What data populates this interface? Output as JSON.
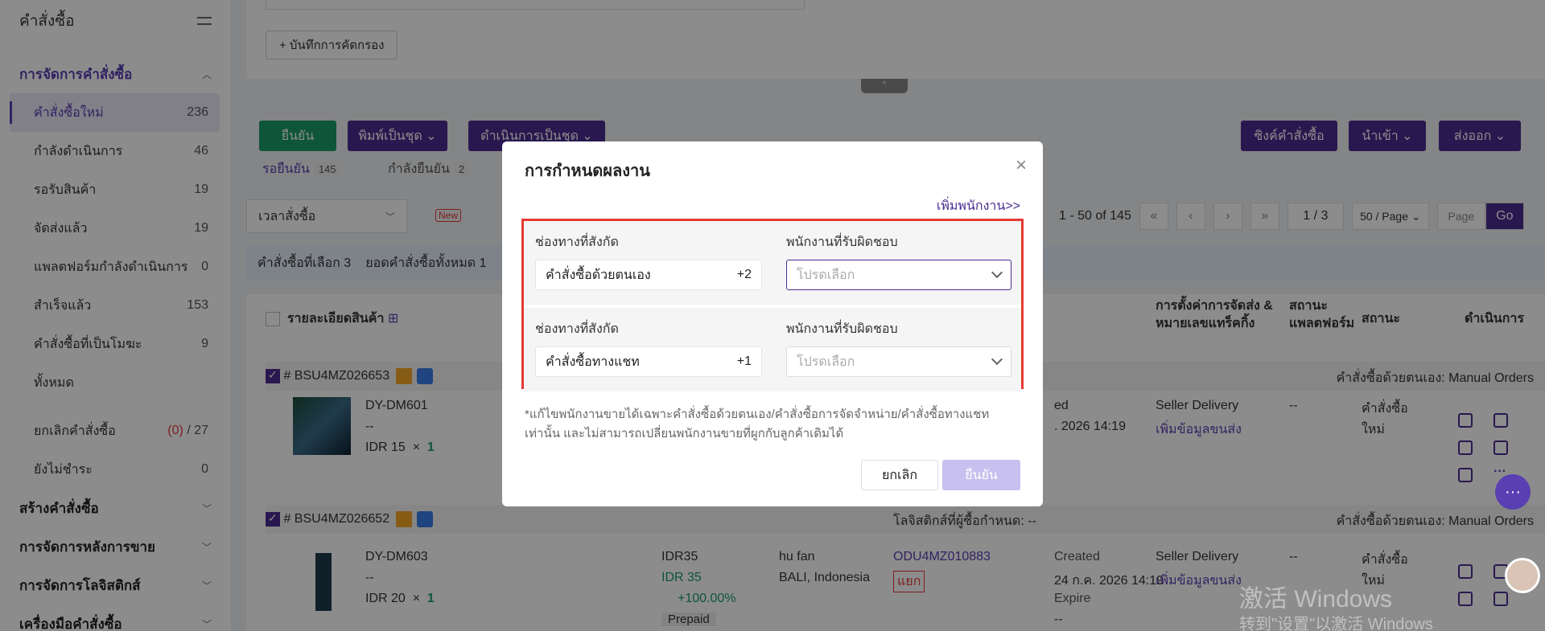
{
  "sidebar": {
    "title": "คำสั่งซื้อ",
    "groups": [
      {
        "label": "การจัดการคำสั่งซื้อ"
      },
      {
        "label": "สร้างคำสั่งซื้อ"
      },
      {
        "label": "การจัดการหลังการขาย"
      },
      {
        "label": "การจัดการโลจิสติกส์"
      },
      {
        "label": "เครื่องมือคำสั่งซื้อ"
      }
    ],
    "items": [
      {
        "label": "คำสั่งซื้อใหม่",
        "count": "236"
      },
      {
        "label": "กำลังดำเนินการ",
        "count": "46"
      },
      {
        "label": "รอรับสินค้า",
        "count": "19"
      },
      {
        "label": "จัดส่งแล้ว",
        "count": "19"
      },
      {
        "label": "แพลตฟอร์มกำลังดำเนินการ",
        "count": "0"
      },
      {
        "label": "สำเร็จแล้ว",
        "count": "153"
      },
      {
        "label": "คำสั่งซื้อที่เป็นโมฆะ",
        "count": "9"
      },
      {
        "label": "ทั้งหมด",
        "count": ""
      },
      {
        "label": "ยกเลิกคำสั่งซื้อ",
        "count_red": "(0)",
        "count": "/ 27"
      },
      {
        "label": "ยังไม่ชำระ",
        "count": "0"
      }
    ]
  },
  "background": {
    "save_filter": "+ บันทึกการคัดกรอง",
    "collapse": "^",
    "confirm": "ยืนยัน",
    "batch_print": "พิมพ์เป็นชุด ⌄",
    "batch_process": "ดำเนินการเป็นชุด ⌄",
    "sync_orders": "ซิงค์คำสั่งซื้อ",
    "import": "นำเข้า ⌄",
    "export": "ส่งออก ⌄",
    "tab_waiting": "รอยืนยัน",
    "tab_waiting_count": "145",
    "tab_confirming": "กำลังยืนยัน",
    "tab_confirming_count": "2",
    "time_select": "เวลาสั่งซื้อ",
    "new_badge": "New",
    "pager_text": "1 - 50 of 145",
    "page_current": "1 / 3",
    "page_size": "50 / Page ⌄",
    "page_placeholder": "Page",
    "go": "Go",
    "selected_info": "คำสั่งซื้อที่เลือก 3",
    "total_info": "ยอดคำสั่งซื้อทั้งหมด 1",
    "col_product": "รายละเอียดสินค้า",
    "col_shipping": "การตั้งค่าการจัดส่ง & หมายเลขแทร็คกิ้ง",
    "col_platform": "สถานะ แพลตฟอร์ม",
    "col_status": "สถานะ",
    "col_action": "ดำเนินการ",
    "orders": [
      {
        "id": "# BSU4MZ026653",
        "channel": "คำสั่งซื้อด้วยตนเอง: Manual Orders",
        "sku": "DY-DM601",
        "dash": "--",
        "price": "IDR 15",
        "qty": "1",
        "created_suffix": "ed",
        "date_partial": ". 2026 14:19",
        "shipping": "Seller Delivery",
        "add_ship": "เพิ่มข้อมูลขนส่ง",
        "platform": "--",
        "status1": "คำสั่งซื้อ",
        "status2": "ใหม่"
      },
      {
        "id": "# BSU4MZ026652",
        "logistics": "โลจิสติกส์ที่ผู้ซื้อกำหนด: --",
        "channel": "คำสั่งซื้อด้วยตนเอง: Manual Orders",
        "sku": "DY-DM603",
        "dash": "--",
        "price": "IDR 20",
        "qty": "1",
        "amount": "IDR35",
        "amount2": "IDR 35",
        "percent": "+100.00%",
        "prepaid": "Prepaid",
        "buyer": "hu fan",
        "location": "BALI, Indonesia",
        "ref": "ODU4MZ010883",
        "split": "แยก",
        "created": "Created",
        "date": "24 ก.ค. 2026 14:19",
        "expire": "Expire",
        "expire_val": "--",
        "shipping": "Seller Delivery",
        "add_ship": "เพิ่มข้อมูลขนส่ง",
        "platform": "--",
        "status1": "คำสั่งซื้อ",
        "status2": "ใหม่"
      }
    ],
    "watermark1": "激活 Windows",
    "watermark2": "转到\"设置\"以激活 Windows"
  },
  "modal": {
    "title": "การกำหนดผลงาน",
    "add_staff": "เพิ่มพนักงาน>>",
    "rows": [
      {
        "channel_label": "ช่องทางที่สังกัด",
        "channel_value": "คำสั่งซื้อด้วยตนเอง",
        "extra": "+2",
        "staff_label": "พนักงานที่รับผิดชอบ",
        "staff_placeholder": "โปรดเลือก"
      },
      {
        "channel_label": "ช่องทางที่สังกัด",
        "channel_value": "คำสั่งซื้อทางแชท",
        "extra": "+1",
        "staff_label": "พนักงานที่รับผิดชอบ",
        "staff_placeholder": "โปรดเลือก"
      }
    ],
    "note": "*แก้ไขพนักงานขายได้เฉพาะคำสั่งซื้อด้วยตนเอง/คำสั่งซื้อการจัดจำหน่าย/คำสั่งซื้อทางแชทเท่านั้น และไม่สามารถเปลี่ยนพนักงานขายที่ผูกกับลูกค้าเดิมได้",
    "cancel": "ยกเลิก",
    "confirm": "ยืนยัน"
  },
  "colors": {
    "accent": "#4b2c91",
    "green": "#1a9c6a",
    "highlight": "#e53935"
  }
}
